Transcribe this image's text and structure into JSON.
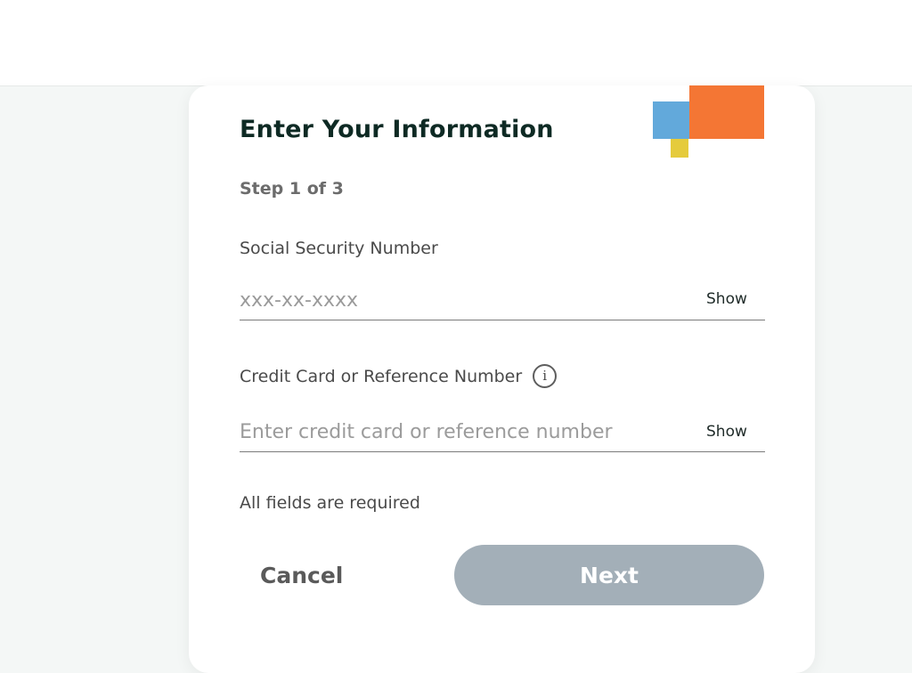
{
  "form": {
    "title": "Enter Your Information",
    "step": "Step 1 of 3",
    "ssn": {
      "label": "Social Security Number",
      "placeholder": "xxx-xx-xxxx",
      "value": "",
      "show_label": "Show"
    },
    "card": {
      "label": "Credit Card or Reference Number",
      "placeholder": "Enter credit card or reference number",
      "value": "",
      "show_label": "Show",
      "info_icon": "info-icon",
      "info_glyph": "i"
    },
    "required_note": "All fields are required",
    "cancel_label": "Cancel",
    "next_label": "Next"
  },
  "logo": {
    "colors": {
      "blue": "#62a9db",
      "orange": "#f47634",
      "yellow": "#e5cb3c"
    }
  },
  "colors": {
    "title": "#0e2a24",
    "next_button_disabled": "#a3afb8"
  }
}
